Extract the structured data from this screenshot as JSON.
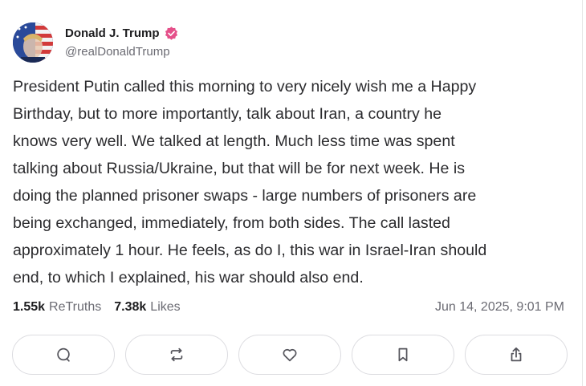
{
  "author": {
    "display_name": "Donald J. Trump",
    "handle": "@realDonaldTrump",
    "verified_color": "#e5508a"
  },
  "post": {
    "lines": [
      "President Putin called this morning to very nicely wish me a Happy",
      "Birthday, but to more importantly, talk about Iran, a country he",
      "knows very well. We talked at length. Much less time was spent",
      "talking about Russia/Ukraine, but that will be for next week. He is",
      "doing the planned prisoner swaps - large numbers of prisoners are",
      "being exchanged, immediately, from both sides. The call lasted",
      "approximately 1 hour. He feels, as do I, this war in Israel-Iran should",
      "end, to which I explained, his war should also end."
    ]
  },
  "stats": {
    "retruths_count": "1.55k",
    "retruths_label": "ReTruths",
    "likes_count": "7.38k",
    "likes_label": "Likes"
  },
  "timestamp": "Jun 14, 2025, 9:01 PM",
  "actions": {
    "icons": [
      "comment-icon",
      "retruth-icon",
      "heart-icon",
      "bookmark-icon",
      "share-icon"
    ],
    "icon_color": "#55555c"
  }
}
